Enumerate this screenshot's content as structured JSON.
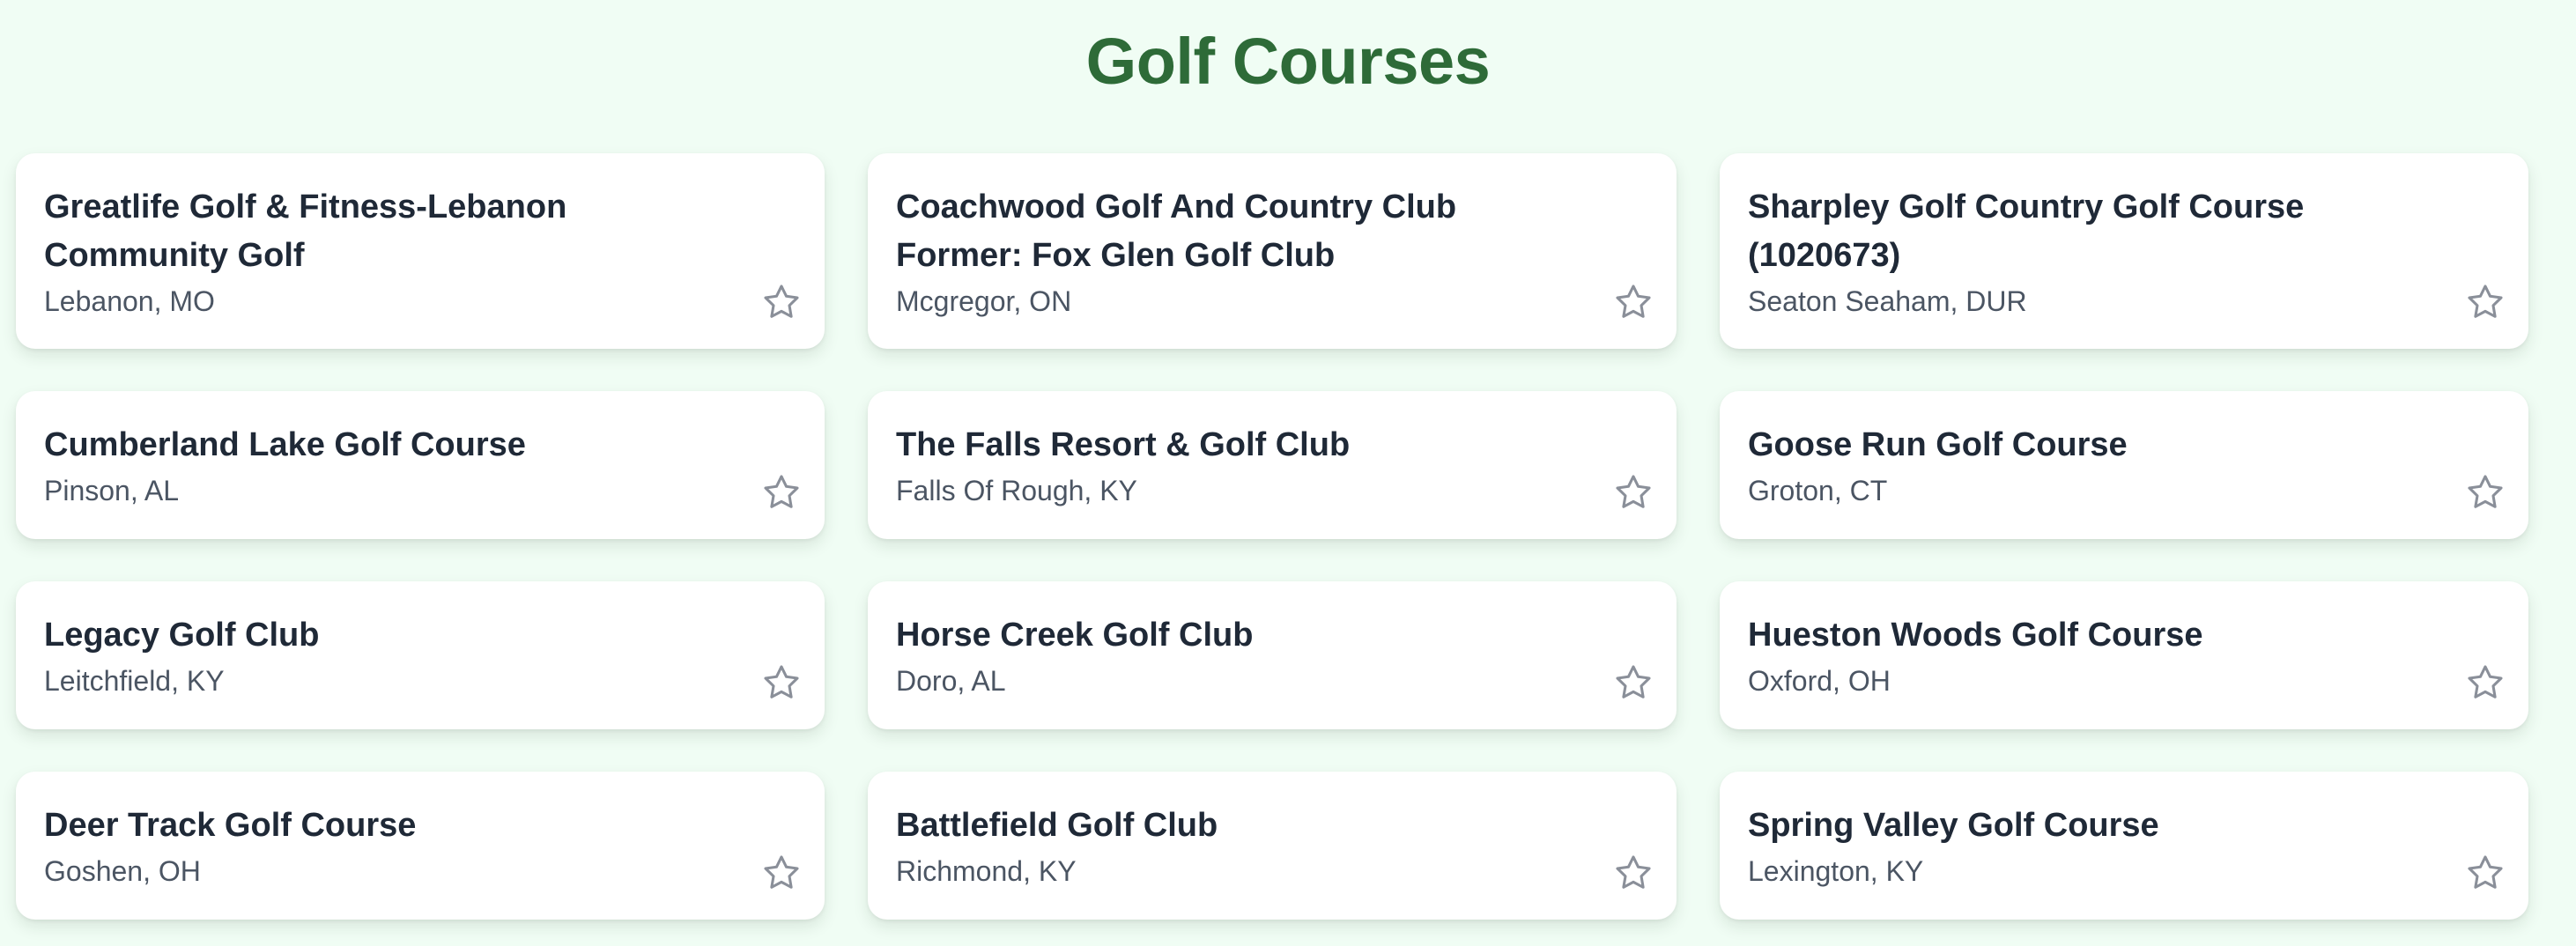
{
  "page": {
    "title": "Golf Courses"
  },
  "colors": {
    "background": "#f0fdf4",
    "title": "#2e6b38",
    "card_background": "#ffffff",
    "card_title": "#1f2937",
    "card_location": "#4b5563",
    "star_outline": "#8a8f99"
  },
  "courses": [
    {
      "name": "Greatlife Golf & Fitness-Lebanon Community Golf",
      "location": "Lebanon, MO",
      "favorite_icon": "star-outline-icon"
    },
    {
      "name": "Coachwood Golf And Country Club Former: Fox Glen Golf Club",
      "location": "Mcgregor, ON",
      "favorite_icon": "star-outline-icon"
    },
    {
      "name": "Sharpley Golf Country Golf Course (1020673)",
      "location": "Seaton Seaham, DUR",
      "favorite_icon": "star-outline-icon"
    },
    {
      "name": "Cumberland Lake Golf Course",
      "location": "Pinson, AL",
      "favorite_icon": "star-outline-icon"
    },
    {
      "name": "The Falls Resort & Golf Club",
      "location": "Falls Of Rough, KY",
      "favorite_icon": "star-outline-icon"
    },
    {
      "name": "Goose Run Golf Course",
      "location": "Groton, CT",
      "favorite_icon": "star-outline-icon"
    },
    {
      "name": "Legacy Golf Club",
      "location": "Leitchfield, KY",
      "favorite_icon": "star-outline-icon"
    },
    {
      "name": "Horse Creek Golf Club",
      "location": "Doro, AL",
      "favorite_icon": "star-outline-icon"
    },
    {
      "name": "Hueston Woods Golf Course",
      "location": "Oxford, OH",
      "favorite_icon": "star-outline-icon"
    },
    {
      "name": "Deer Track Golf Course",
      "location": "Goshen, OH",
      "favorite_icon": "star-outline-icon"
    },
    {
      "name": "Battlefield Golf Club",
      "location": "Richmond, KY",
      "favorite_icon": "star-outline-icon"
    },
    {
      "name": "Spring Valley Golf Course",
      "location": "Lexington, KY",
      "favorite_icon": "star-outline-icon"
    }
  ]
}
